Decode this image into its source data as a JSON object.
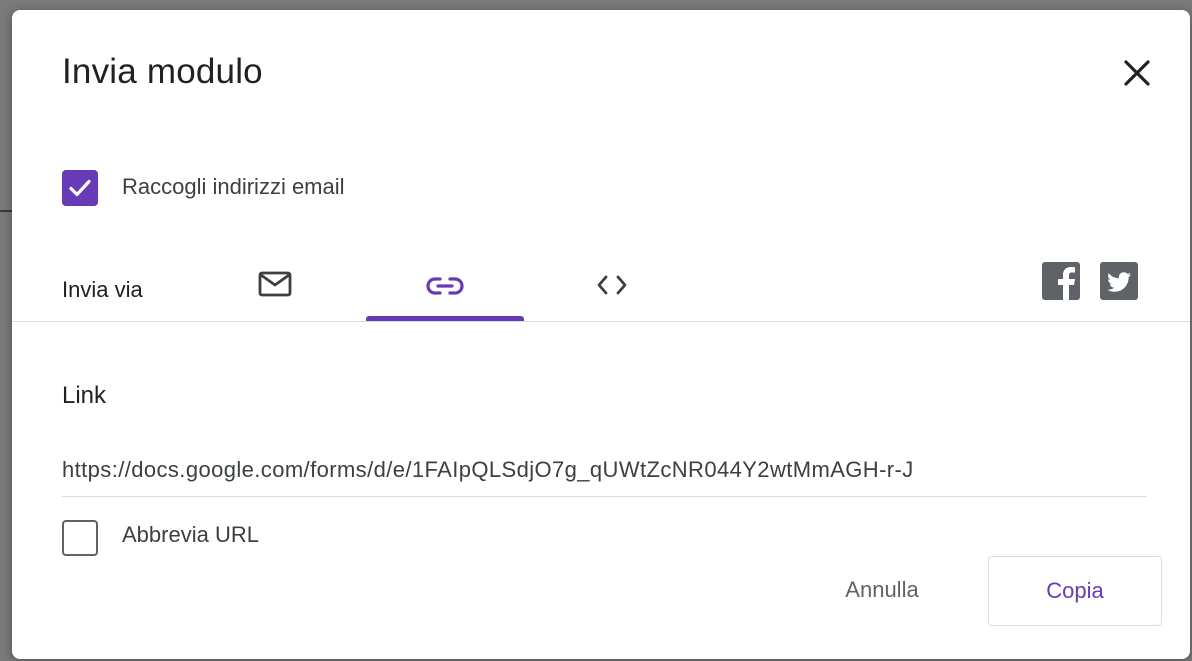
{
  "dialog": {
    "title": "Invia modulo",
    "close_icon": "close-icon"
  },
  "collect_emails": {
    "label": "Raccogli indirizzi email",
    "checked": true
  },
  "send_via": {
    "label": "Invia via",
    "tabs": [
      {
        "name": "email",
        "icon": "mail-icon",
        "selected": false
      },
      {
        "name": "link",
        "icon": "link-icon",
        "selected": true
      },
      {
        "name": "embed",
        "icon": "code-icon",
        "selected": false
      }
    ],
    "social": [
      {
        "name": "facebook",
        "icon": "facebook-icon",
        "glyph": "f"
      },
      {
        "name": "twitter",
        "icon": "twitter-icon"
      }
    ]
  },
  "link_section": {
    "title": "Link",
    "url": "https://docs.google.com/forms/d/e/1FAIpQLSdjO7g_qUWtZcNR044Y2wtMmAGH-r-J",
    "shorten_label": "Abbrevia URL",
    "shorten_checked": false
  },
  "actions": {
    "cancel_label": "Annulla",
    "copy_label": "Copia"
  },
  "colors": {
    "accent": "#673ab7",
    "text_primary": "#202124",
    "text_secondary": "#5f6368",
    "divider": "#dadce0"
  }
}
